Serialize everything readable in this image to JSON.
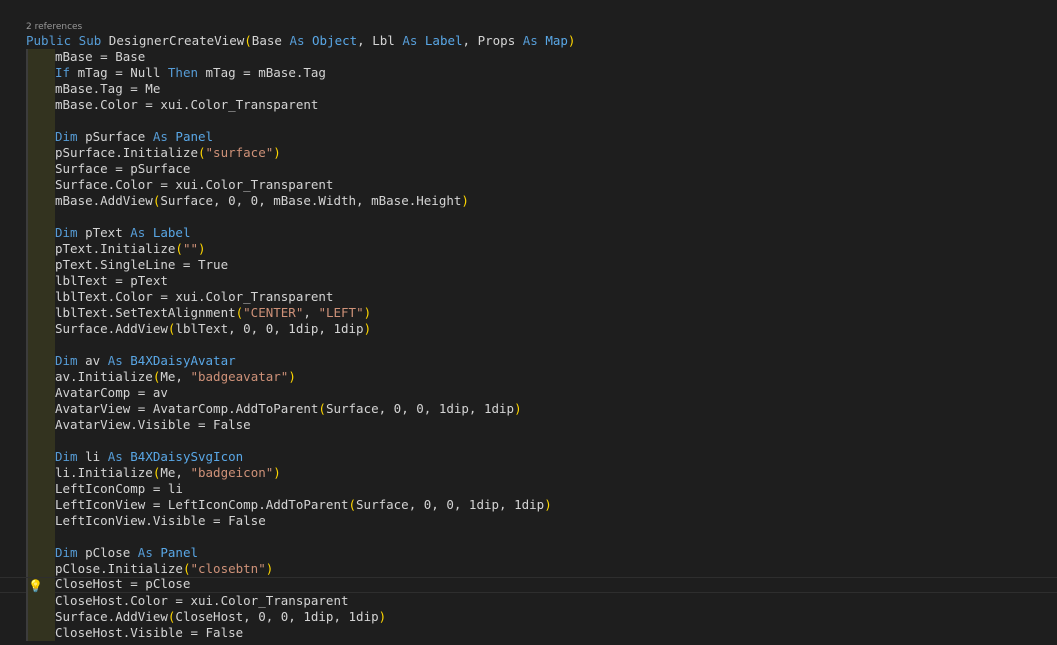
{
  "codelens": {
    "references_label": "2 references"
  },
  "lightbulb": {
    "icon": "lightbulb-icon",
    "glyph": "💡"
  },
  "colors": {
    "keyword": "#569cd6",
    "type": "#4ec9b0",
    "string": "#ce9178",
    "bracket": "#ffd700",
    "text": "#d4d4d4",
    "background": "#1e1e1e"
  },
  "lines": [
    {
      "tokens": [
        [
          "kw",
          "Public Sub "
        ],
        [
          "pl",
          "DesignerCreateView"
        ],
        [
          "br",
          "("
        ],
        [
          "pl",
          "Base "
        ],
        [
          "kw",
          "As "
        ],
        [
          "ty2",
          "Object"
        ],
        [
          "pl",
          ", Lbl "
        ],
        [
          "kw",
          "As "
        ],
        [
          "ty2",
          "Label"
        ],
        [
          "pl",
          ", Props "
        ],
        [
          "kw",
          "As "
        ],
        [
          "ty2",
          "Map"
        ],
        [
          "br",
          ")"
        ]
      ]
    },
    {
      "tokens": [
        [
          "pl",
          "mBase = Base"
        ]
      ]
    },
    {
      "tokens": [
        [
          "kw",
          "If "
        ],
        [
          "pl",
          "mTag = Null "
        ],
        [
          "kw",
          "Then "
        ],
        [
          "pl",
          "mTag = mBase.Tag"
        ]
      ]
    },
    {
      "tokens": [
        [
          "pl",
          "mBase.Tag = Me"
        ]
      ]
    },
    {
      "tokens": [
        [
          "pl",
          "mBase.Color = xui.Color_Transparent"
        ]
      ]
    },
    {
      "tokens": []
    },
    {
      "tokens": [
        [
          "kw",
          "Dim "
        ],
        [
          "pl",
          "pSurface "
        ],
        [
          "kw",
          "As "
        ],
        [
          "ty2",
          "Panel"
        ]
      ]
    },
    {
      "tokens": [
        [
          "pl",
          "pSurface.Initialize"
        ],
        [
          "br",
          "("
        ],
        [
          "st",
          "\"surface\""
        ],
        [
          "br",
          ")"
        ]
      ]
    },
    {
      "tokens": [
        [
          "pl",
          "Surface = pSurface"
        ]
      ]
    },
    {
      "tokens": [
        [
          "pl",
          "Surface.Color = xui.Color_Transparent"
        ]
      ]
    },
    {
      "tokens": [
        [
          "pl",
          "mBase.AddView"
        ],
        [
          "br",
          "("
        ],
        [
          "pl",
          "Surface, 0, 0, mBase.Width, mBase.Height"
        ],
        [
          "br",
          ")"
        ]
      ]
    },
    {
      "tokens": []
    },
    {
      "tokens": [
        [
          "kw",
          "Dim "
        ],
        [
          "pl",
          "pText "
        ],
        [
          "kw",
          "As "
        ],
        [
          "ty2",
          "Label"
        ]
      ]
    },
    {
      "tokens": [
        [
          "pl",
          "pText.Initialize"
        ],
        [
          "br",
          "("
        ],
        [
          "st",
          "\"\""
        ],
        [
          "br",
          ")"
        ]
      ]
    },
    {
      "tokens": [
        [
          "pl",
          "pText.SingleLine = True"
        ]
      ]
    },
    {
      "tokens": [
        [
          "pl",
          "lblText = pText"
        ]
      ]
    },
    {
      "tokens": [
        [
          "pl",
          "lblText.Color = xui.Color_Transparent"
        ]
      ]
    },
    {
      "tokens": [
        [
          "pl",
          "lblText.SetTextAlignment"
        ],
        [
          "br",
          "("
        ],
        [
          "st",
          "\"CENTER\""
        ],
        [
          "pl",
          ", "
        ],
        [
          "st",
          "\"LEFT\""
        ],
        [
          "br",
          ")"
        ]
      ]
    },
    {
      "tokens": [
        [
          "pl",
          "Surface.AddView"
        ],
        [
          "br",
          "("
        ],
        [
          "pl",
          "lblText, 0, 0, 1dip, 1dip"
        ],
        [
          "br",
          ")"
        ]
      ]
    },
    {
      "tokens": []
    },
    {
      "tokens": [
        [
          "kw",
          "Dim "
        ],
        [
          "pl",
          "av "
        ],
        [
          "kw",
          "As "
        ],
        [
          "ty2",
          "B4XDaisyAvatar"
        ]
      ]
    },
    {
      "tokens": [
        [
          "pl",
          "av.Initialize"
        ],
        [
          "br",
          "("
        ],
        [
          "pl",
          "Me, "
        ],
        [
          "st",
          "\"badgeavatar\""
        ],
        [
          "br",
          ")"
        ]
      ]
    },
    {
      "tokens": [
        [
          "pl",
          "AvatarComp = av"
        ]
      ]
    },
    {
      "tokens": [
        [
          "pl",
          "AvatarView = AvatarComp.AddToParent"
        ],
        [
          "br",
          "("
        ],
        [
          "pl",
          "Surface, 0, 0, 1dip, 1dip"
        ],
        [
          "br",
          ")"
        ]
      ]
    },
    {
      "tokens": [
        [
          "pl",
          "AvatarView.Visible = False"
        ]
      ]
    },
    {
      "tokens": []
    },
    {
      "tokens": [
        [
          "kw",
          "Dim "
        ],
        [
          "pl",
          "li "
        ],
        [
          "kw",
          "As "
        ],
        [
          "ty2",
          "B4XDaisySvgIcon"
        ]
      ]
    },
    {
      "tokens": [
        [
          "pl",
          "li.Initialize"
        ],
        [
          "br",
          "("
        ],
        [
          "pl",
          "Me, "
        ],
        [
          "st",
          "\"badgeicon\""
        ],
        [
          "br",
          ")"
        ]
      ]
    },
    {
      "tokens": [
        [
          "pl",
          "LeftIconComp = li"
        ]
      ]
    },
    {
      "tokens": [
        [
          "pl",
          "LeftIconView = LeftIconComp.AddToParent"
        ],
        [
          "br",
          "("
        ],
        [
          "pl",
          "Surface, 0, 0, 1dip, 1dip"
        ],
        [
          "br",
          ")"
        ]
      ]
    },
    {
      "tokens": [
        [
          "pl",
          "LeftIconView.Visible = False"
        ]
      ]
    },
    {
      "tokens": []
    },
    {
      "tokens": [
        [
          "kw",
          "Dim "
        ],
        [
          "pl",
          "pClose "
        ],
        [
          "kw",
          "As "
        ],
        [
          "ty2",
          "Panel"
        ]
      ]
    },
    {
      "tokens": [
        [
          "pl",
          "pClose.Initialize"
        ],
        [
          "br",
          "("
        ],
        [
          "st",
          "\"closebtn\""
        ],
        [
          "br",
          ")"
        ]
      ]
    },
    {
      "tokens": [
        [
          "pl",
          "CloseHost = pClose"
        ]
      ]
    },
    {
      "tokens": [
        [
          "pl",
          "CloseHost.Color = xui.Color_Transparent"
        ]
      ]
    },
    {
      "tokens": [
        [
          "pl",
          "Surface.AddView"
        ],
        [
          "br",
          "("
        ],
        [
          "pl",
          "CloseHost, 0, 0, 1dip, 1dip"
        ],
        [
          "br",
          ")"
        ]
      ]
    },
    {
      "tokens": [
        [
          "pl",
          "CloseHost.Visible = False"
        ]
      ]
    }
  ]
}
